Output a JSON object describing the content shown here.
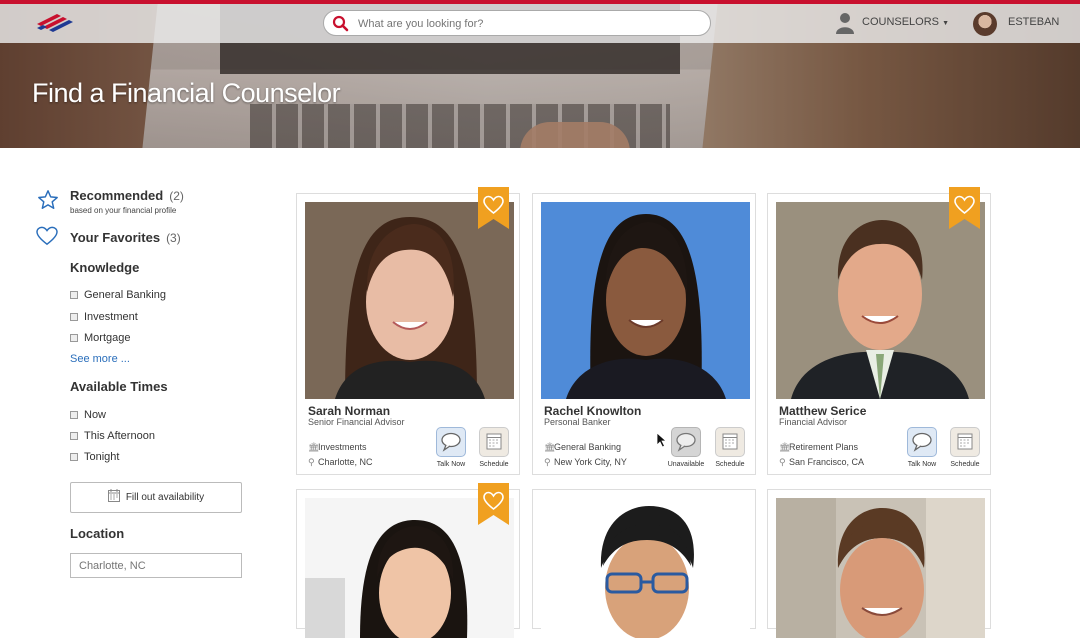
{
  "nav": {
    "search_placeholder": "What are you looking for?",
    "counselors_label": "COUNSELORS",
    "user_label": "ESTEBAN"
  },
  "hero": {
    "title": "Find a Financial Counselor"
  },
  "sidebar": {
    "recommended": {
      "label": "Recommended",
      "count": "(2)",
      "subtitle": "based on your financial profile"
    },
    "favorites": {
      "label": "Your Favorites",
      "count": "(3)"
    },
    "knowledge": {
      "heading": "Knowledge",
      "options": [
        "General Banking",
        "Investment",
        "Mortgage"
      ],
      "see_more": "See more ..."
    },
    "times": {
      "heading": "Available Times",
      "options": [
        "Now",
        "This Afternoon",
        "Tonight"
      ],
      "fill_button": "Fill out availability"
    },
    "location": {
      "heading": "Location",
      "placeholder": "Charlotte, NC"
    }
  },
  "cards": [
    {
      "name": "Sarah Norman",
      "title": "Senior Financial Advisor",
      "specialty": "Investments",
      "location": "Charlotte, NC",
      "talk_label": "Talk Now",
      "schedule_label": "Schedule",
      "favorite": true
    },
    {
      "name": "Rachel Knowlton",
      "title": "Personal Banker",
      "specialty": "General Banking",
      "location": "New York City, NY",
      "talk_label": "Unavailable",
      "schedule_label": "Schedule",
      "favorite": false
    },
    {
      "name": "Matthew Serice",
      "title": "Financial Advisor",
      "specialty": "Retirement Plans",
      "location": "San Francisco, CA",
      "talk_label": "Talk Now",
      "schedule_label": "Schedule",
      "favorite": true
    }
  ],
  "colors": {
    "accent_red": "#c8102e",
    "ribbon_orange": "#f0a020",
    "link_blue": "#2a6ebb",
    "icon_blue": "#2a6ebb"
  }
}
